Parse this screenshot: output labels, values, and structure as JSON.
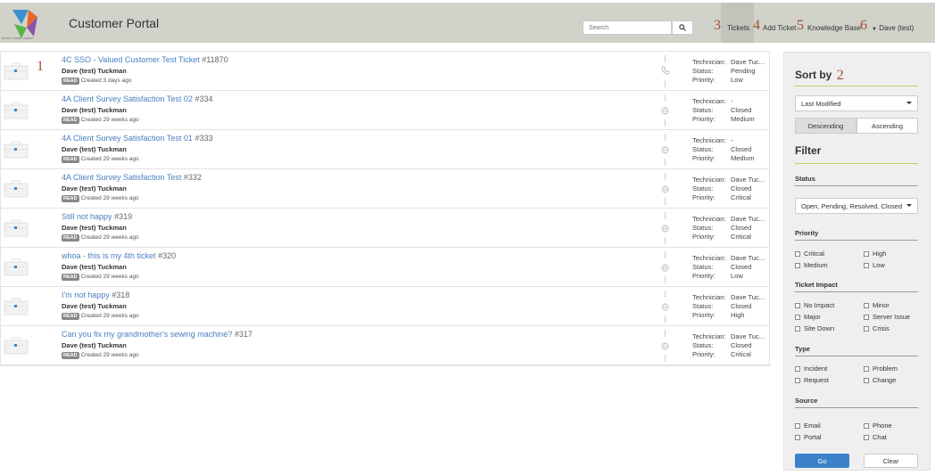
{
  "header": {
    "logo_subtext": "secure smart ontime",
    "title": "Customer Portal",
    "search_placeholder": "Search",
    "nav": [
      {
        "num": "3",
        "label": "Tickets",
        "active": true
      },
      {
        "num": "4",
        "label": "Add Ticket"
      },
      {
        "num": "5",
        "label": "Knowledge Base"
      },
      {
        "num": "6",
        "label": "Dave (test)"
      }
    ]
  },
  "list": {
    "row1_num": "1",
    "field_labels": {
      "technician": "Technician:",
      "status": "Status:",
      "priority": "Priority:"
    },
    "tickets": [
      {
        "title": "4C SSO - Valued Customer Test Ticket",
        "number": "#11870",
        "user": "Dave (test) Tuckman",
        "badge": "READ",
        "created": "Created 3 days ago",
        "technician": "Dave Tuc...",
        "status": "Pending",
        "priority": "Low",
        "source_icon": "phone"
      },
      {
        "title": "4A Client Survey Satisfaction Test 02",
        "number": "#334",
        "user": "Dave (test) Tuckman",
        "badge": "READ",
        "created": "Created 29 weeks ago",
        "technician": "-",
        "status": "Closed",
        "priority": "Medium",
        "source_icon": "globe"
      },
      {
        "title": "4A Client Survey Satisfaction Test 01",
        "number": "#333",
        "user": "Dave (test) Tuckman",
        "badge": "READ",
        "created": "Created 29 weeks ago",
        "technician": "-",
        "status": "Closed",
        "priority": "Medium",
        "source_icon": "globe"
      },
      {
        "title": "4A Client Survey Satisfaction Test",
        "number": "#332",
        "user": "Dave (test) Tuckman",
        "badge": "READ",
        "created": "Created 29 weeks ago",
        "technician": "Dave Tuc...",
        "status": "Closed",
        "priority": "Critical",
        "source_icon": "globe"
      },
      {
        "title": "Still not happy",
        "number": "#319",
        "user": "Dave (test) Tuckman",
        "badge": "READ",
        "created": "Created 29 weeks ago",
        "technician": "Dave Tuc...",
        "status": "Closed",
        "priority": "Critical",
        "source_icon": "globe"
      },
      {
        "title": "whoa - this is my 4th ticket",
        "number": "#320",
        "user": "Dave (test) Tuckman",
        "badge": "READ",
        "created": "Created 29 weeks ago",
        "technician": "Dave Tuc...",
        "status": "Closed",
        "priority": "Low",
        "source_icon": "globe"
      },
      {
        "title": "I'm not happy",
        "number": "#318",
        "user": "Dave (test) Tuckman",
        "badge": "READ",
        "created": "Created 29 weeks ago",
        "technician": "Dave Tuc...",
        "status": "Closed",
        "priority": "High",
        "source_icon": "globe"
      },
      {
        "title": "Can you fix my grandmother's sewing machine?",
        "number": "#317",
        "user": "Dave (test) Tuckman",
        "badge": "READ",
        "created": "Created 29 weeks ago",
        "technician": "Dave Tuc...",
        "status": "Closed",
        "priority": "Critical",
        "source_icon": "globe"
      }
    ]
  },
  "sidebar": {
    "sort_title": "Sort by",
    "sort_num": "2",
    "sort_value": "Last Modified",
    "order_desc": "Descending",
    "order_asc": "Ascending",
    "filter_title": "Filter",
    "status_label": "Status",
    "status_value": "Open, Pending, Resolved, Closed",
    "priority_label": "Priority",
    "priority_options": [
      "Critical",
      "High",
      "Medium",
      "Low"
    ],
    "impact_label": "Ticket Impact",
    "impact_options": [
      "No Impact",
      "Minor",
      "Major",
      "Server Issue",
      "Site Down",
      "Crisis"
    ],
    "type_label": "Type",
    "type_options": [
      "Incident",
      "Problem",
      "Request",
      "Change"
    ],
    "source_label": "Source",
    "source_options": [
      "Email",
      "Phone",
      "Portal",
      "Chat"
    ],
    "go_label": "Go",
    "clear_label": "Clear"
  },
  "colors": {
    "accent": "#a0522d",
    "header_bg": "#d1d2c9",
    "link": "#4a7fc1",
    "go_button": "#3b82c8"
  }
}
